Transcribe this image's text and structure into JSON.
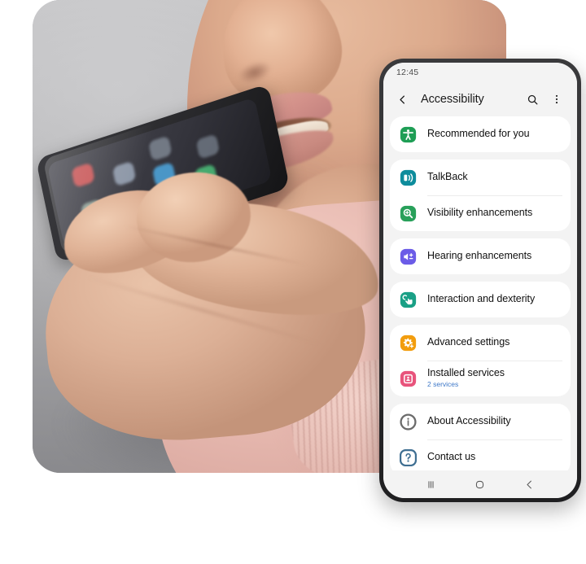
{
  "photo": {
    "alt": "Woman speaking into a smartphone held near her mouth",
    "background_color": "#b0b0b3",
    "sweater_color": "#e9bcb3",
    "skin_color": "#dcb096"
  },
  "phone": {
    "frame_color": "#2c2c2e",
    "screen_background": "#f3f3f3",
    "card_background": "#ffffff",
    "statusbar": {
      "time": "12:45"
    },
    "appbar": {
      "back_icon": "chevron-left-icon",
      "title": "Accessibility",
      "search_icon": "search-icon",
      "menu_icon": "more-vertical-icon"
    },
    "groups": [
      {
        "items": [
          {
            "label": "Recommended for you",
            "sub": "",
            "icon": "accessibility-person-icon",
            "icon_color": "#1e9e55"
          }
        ]
      },
      {
        "items": [
          {
            "label": "TalkBack",
            "sub": "",
            "icon": "talkback-speaker-icon",
            "icon_color": "#0e8c9c"
          },
          {
            "label": "Visibility enhancements",
            "sub": "",
            "icon": "magnifier-icon",
            "icon_color": "#28a05a"
          }
        ]
      },
      {
        "items": [
          {
            "label": "Hearing enhancements",
            "sub": "",
            "icon": "volume-icon",
            "icon_color": "#6b5ce7"
          }
        ]
      },
      {
        "items": [
          {
            "label": "Interaction and dexterity",
            "sub": "",
            "icon": "hand-touch-icon",
            "icon_color": "#1aa086"
          }
        ]
      },
      {
        "items": [
          {
            "label": "Advanced settings",
            "sub": "",
            "icon": "gear-plus-icon",
            "icon_color": "#f29d0e"
          },
          {
            "label": "Installed services",
            "sub": "2 services",
            "icon": "installed-services-icon",
            "icon_color": "#e8547c"
          }
        ]
      },
      {
        "items": [
          {
            "label": "About Accessibility",
            "sub": "",
            "icon": "info-icon",
            "icon_color": "#6b6b6b"
          },
          {
            "label": "Contact us",
            "sub": "",
            "icon": "question-icon",
            "icon_color": "#3f6f92"
          }
        ]
      }
    ],
    "navbar": {
      "recents_icon": "recents-icon",
      "home_icon": "home-circle-icon",
      "back_icon": "nav-back-icon"
    },
    "accent_color": "#3e78c8"
  }
}
